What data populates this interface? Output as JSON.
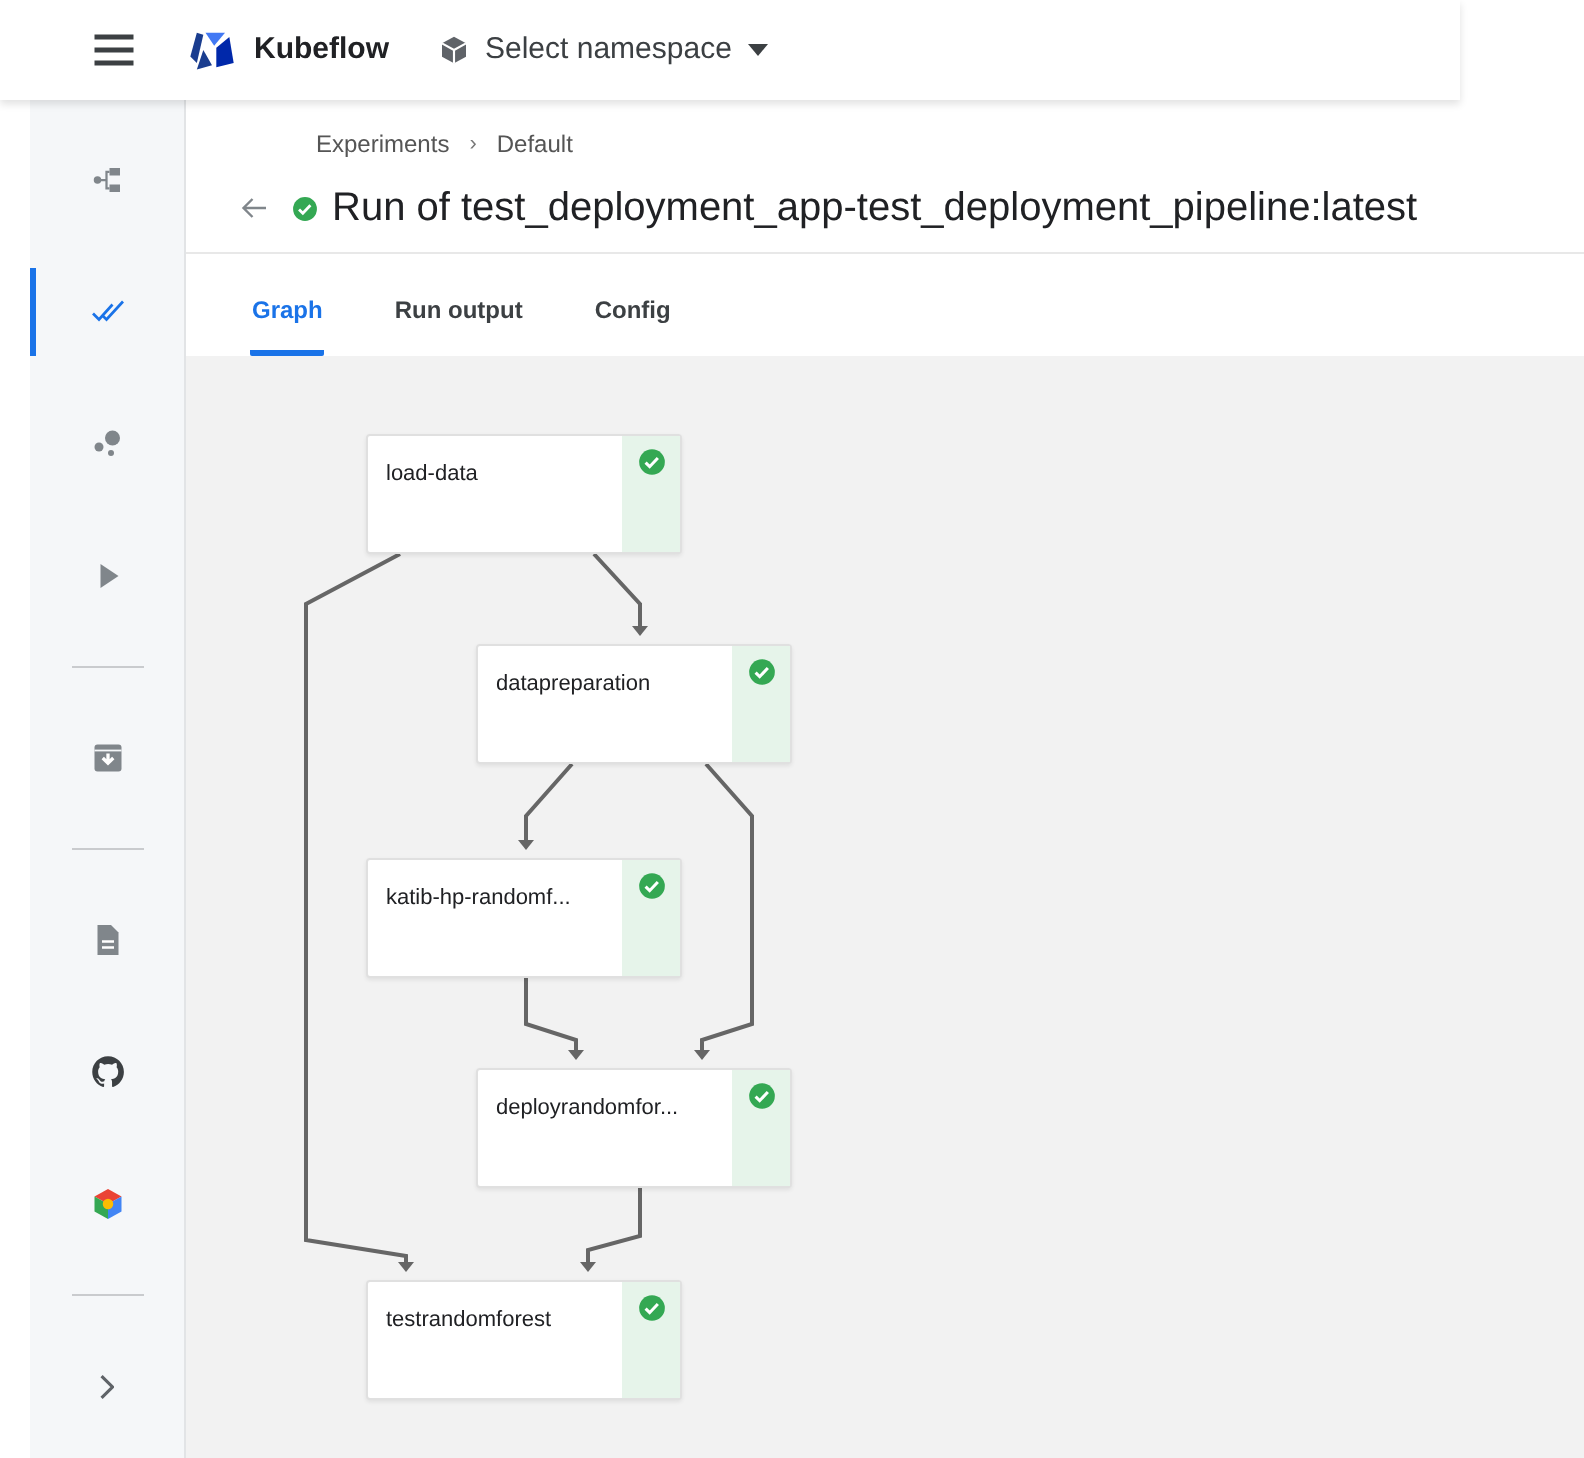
{
  "top_bar": {
    "brand": "Kubeflow",
    "namespace": "Select namespace"
  },
  "sidebar": {
    "items": [
      {
        "kind": "pipelines",
        "selected": false
      },
      {
        "kind": "experiments",
        "selected": true
      },
      {
        "kind": "artifacts",
        "selected": false
      },
      {
        "kind": "executions",
        "selected": false
      },
      {
        "kind": "divider"
      },
      {
        "kind": "archive",
        "selected": false
      },
      {
        "kind": "divider"
      },
      {
        "kind": "docs",
        "selected": false
      },
      {
        "kind": "github",
        "selected": false
      },
      {
        "kind": "cloud",
        "selected": false
      },
      {
        "kind": "divider"
      },
      {
        "kind": "expand",
        "selected": false
      }
    ]
  },
  "breadcrumb": [
    {
      "label": "Experiments"
    },
    {
      "label": "Default"
    }
  ],
  "breadcrumb_separator": "›",
  "title": {
    "text": "Run of test_deployment_app-test_deployment_pipeline:latest",
    "succeeded": true
  },
  "tabs": [
    {
      "label": "Graph",
      "selected": true
    },
    {
      "label": "Run output",
      "selected": false
    },
    {
      "label": "Config",
      "selected": false
    }
  ],
  "graph": {
    "nodes": [
      {
        "label": "load-data",
        "succeeded": true
      },
      {
        "label": "datapreparation",
        "succeeded": true
      },
      {
        "label": "katib-hp-randomf...",
        "succeeded": true
      },
      {
        "label": "deployrandomfor...",
        "succeeded": true
      },
      {
        "label": "testrandomforest",
        "succeeded": true
      }
    ]
  }
}
